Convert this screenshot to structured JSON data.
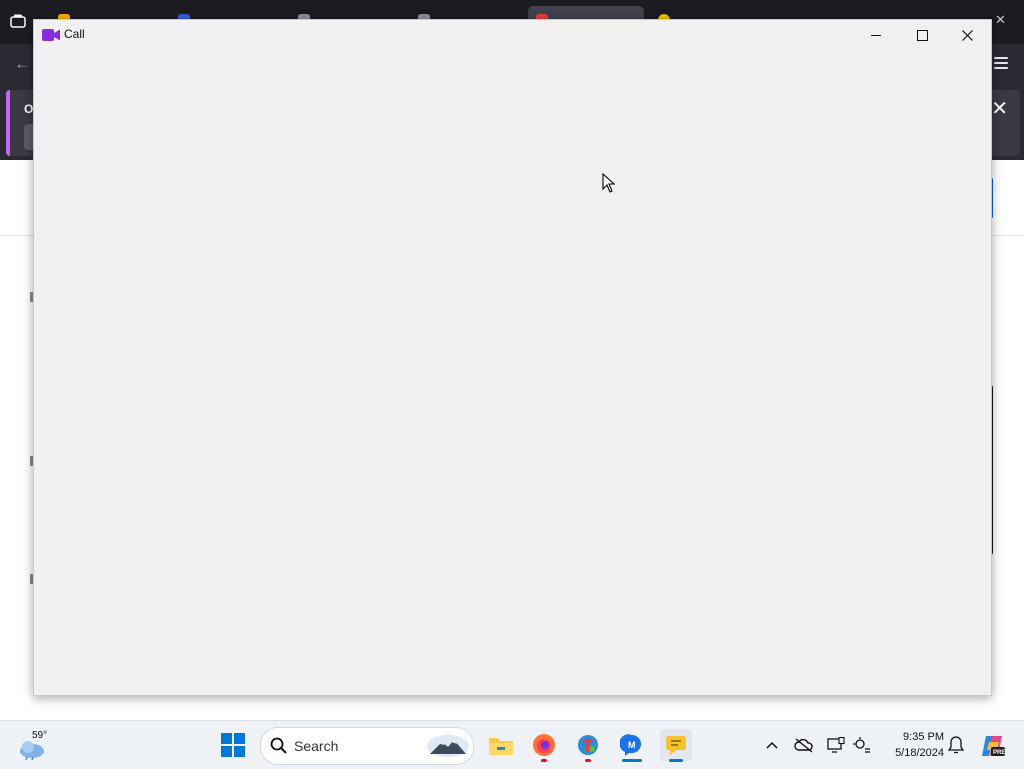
{
  "call_window": {
    "title": "Call"
  },
  "colors": {
    "accent": "#0078d4",
    "window_bg": "#f0f0f0",
    "call_icon": "#8a2be2",
    "banner_accent": "#c565ff"
  },
  "browser": {
    "banner_title": "Op"
  },
  "taskbar": {
    "weather_temp": "59°",
    "search_placeholder": "Search",
    "clock_time": "9:35 PM",
    "clock_date": "5/18/2024",
    "icons": [
      "weather-icon",
      "start-icon",
      "search-icon",
      "file-explorer-icon",
      "firefox-icon",
      "network-app-icon",
      "messenger-icon",
      "chat-app-icon",
      "show-hidden-icons-chevron",
      "onedrive-icon",
      "display-icon",
      "settings-sync-icon",
      "notification-bell-icon",
      "copilot-icon"
    ]
  }
}
